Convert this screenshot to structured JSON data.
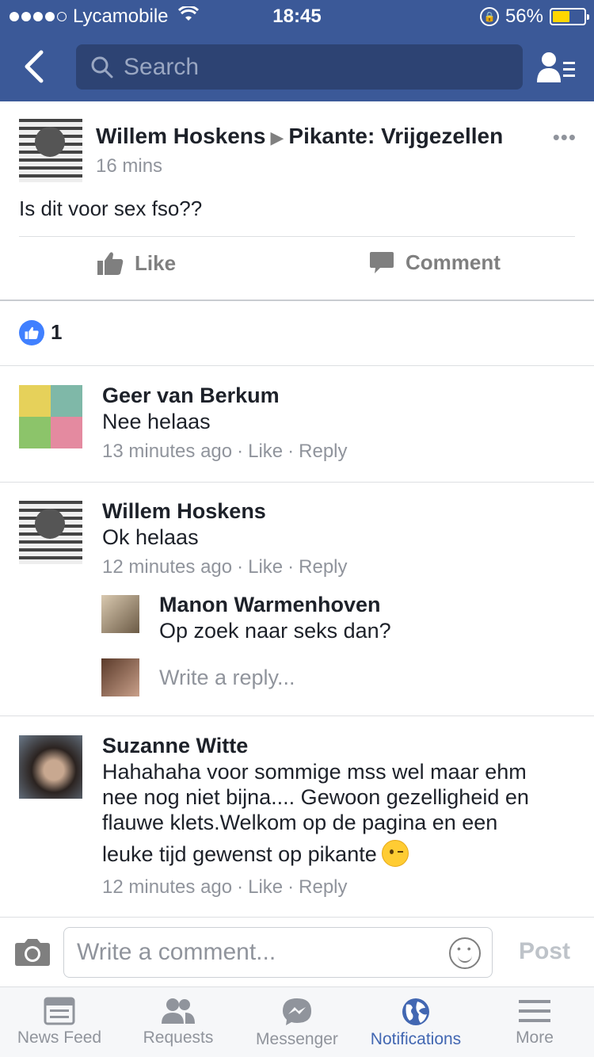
{
  "status_bar": {
    "carrier": "Lycamobile",
    "time": "18:45",
    "battery": "56%",
    "battery_level": 0.56
  },
  "nav": {
    "search_placeholder": "Search"
  },
  "post": {
    "author": "Willem Hoskens",
    "group": "Pikante: Vrijgezellen",
    "time": "16 mins",
    "text": "Is dit voor sex fso??",
    "like_label": "Like",
    "comment_label": "Comment",
    "like_count": "1"
  },
  "comments": [
    {
      "name": "Geer van Berkum",
      "text": "Nee helaas",
      "time": "13 minutes ago",
      "like": "Like",
      "reply": "Reply"
    },
    {
      "name": "Willem Hoskens",
      "text": "Ok helaas",
      "time": "12 minutes ago",
      "like": "Like",
      "reply": "Reply",
      "replies": [
        {
          "name": "Manon Warmenhoven",
          "text": "Op zoek naar seks dan?"
        }
      ],
      "reply_placeholder": "Write a reply..."
    },
    {
      "name": "Suzanne Witte",
      "text_line1": "Hahahaha voor sommige mss wel maar ehm",
      "text_line2": "nee nog niet bijna.... Gewoon gezelligheid en",
      "text_line3": "flauwe klets.Welkom op de pagina en een",
      "text_line4": "leuke tijd gewenst op pikante",
      "time": "12 minutes ago",
      "like": "Like",
      "reply": "Reply"
    }
  ],
  "composer": {
    "placeholder": "Write a comment...",
    "post_label": "Post"
  },
  "tabs": [
    {
      "label": "News Feed",
      "icon": "news-feed-icon"
    },
    {
      "label": "Requests",
      "icon": "requests-icon"
    },
    {
      "label": "Messenger",
      "icon": "messenger-icon"
    },
    {
      "label": "Notifications",
      "icon": "globe-icon",
      "active": true
    },
    {
      "label": "More",
      "icon": "menu-icon"
    }
  ],
  "colors": {
    "brand": "#3b5998",
    "active_tab": "#4267b2",
    "like_blue": "#4080ff"
  }
}
